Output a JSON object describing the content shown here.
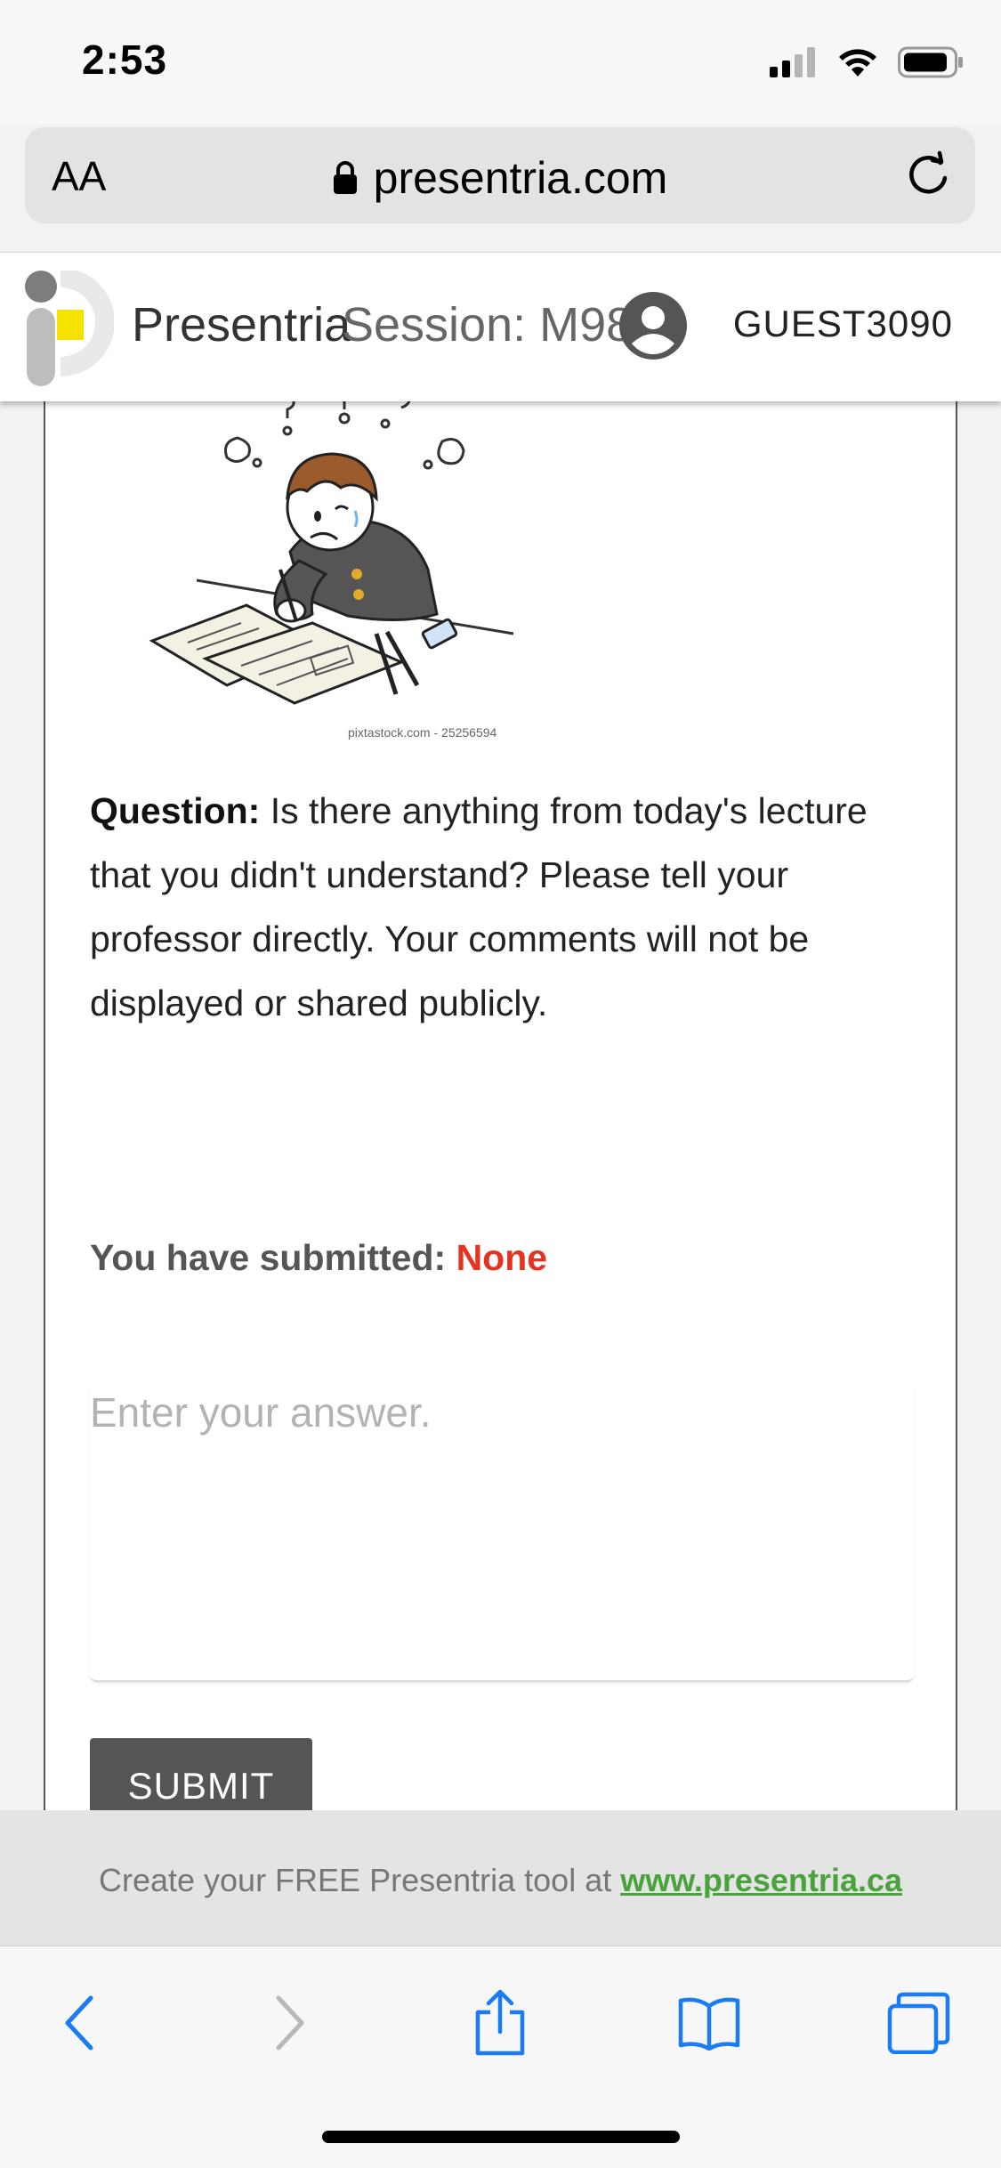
{
  "status_bar": {
    "time": "2:53"
  },
  "browser": {
    "text_size_label": "AA",
    "domain": "presentria.com"
  },
  "header": {
    "brand": "Presentria",
    "session": "Session: M98",
    "user": "GUEST3090"
  },
  "content": {
    "image_credit": "pixtastock.com - 25256594",
    "question_label": "Question:",
    "question_text": " Is there anything from today's lecture that you didn't understand? Please tell your professor directly. Your comments will not be displayed or shared publicly.",
    "submitted_label": "You have submitted: ",
    "submitted_value": "None",
    "answer_placeholder": "Enter your answer.",
    "submit_label": "SUBMIT"
  },
  "footer": {
    "promo_text": "Create your FREE Presentria tool at ",
    "promo_link": "www.presentria.ca"
  },
  "colors": {
    "accent_red": "#e53322",
    "link_green": "#4aa23c",
    "ios_blue": "#1a7cf5",
    "logo_yellow": "#f5e200"
  },
  "toolbar": {
    "icons": [
      "back-icon",
      "forward-icon",
      "share-icon",
      "bookmarks-icon",
      "tabs-icon"
    ]
  }
}
